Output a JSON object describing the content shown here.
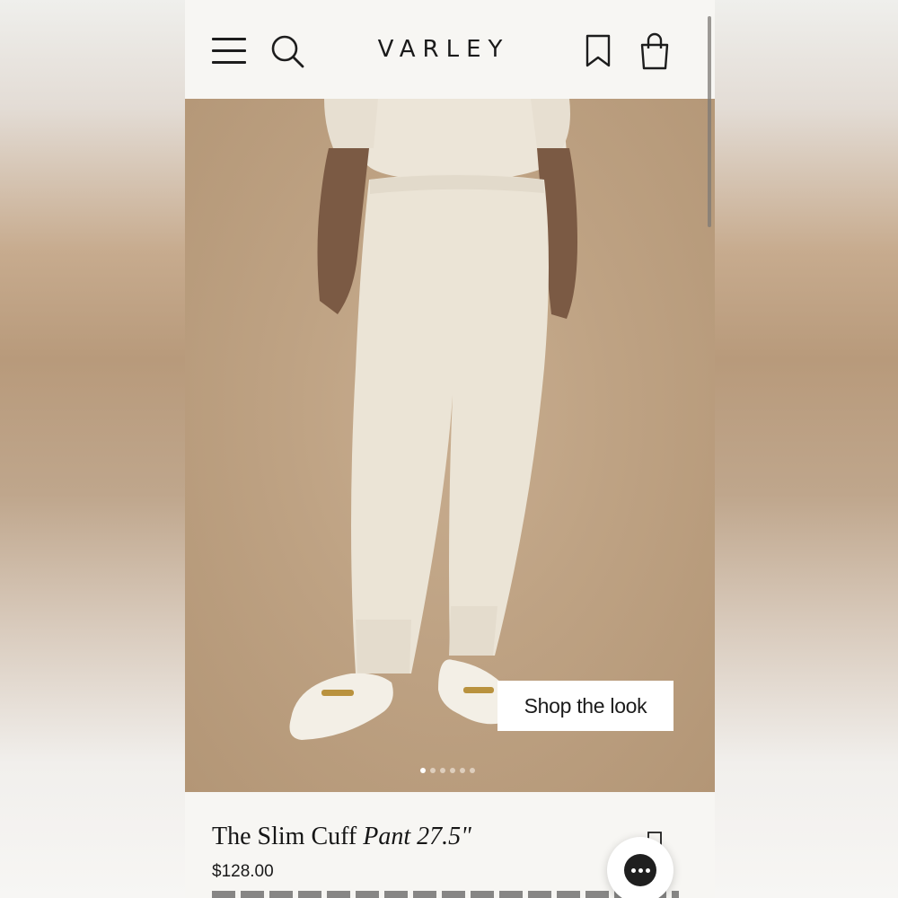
{
  "header": {
    "logo": "VARLEY",
    "icons": [
      "menu-icon",
      "search-icon",
      "bookmark-icon",
      "bag-icon"
    ]
  },
  "hero": {
    "shop_button_label": "Shop the look",
    "carousel": {
      "count": 6,
      "active_index": 0
    }
  },
  "product": {
    "title_main": "The Slim Cuff ",
    "title_italic": "Pant 27.5\"",
    "price": "$128.00"
  },
  "colors": {
    "background": "#f7f6f3",
    "hero": "#bea283",
    "text": "#1a1a1a",
    "button_bg": "#ffffff"
  }
}
